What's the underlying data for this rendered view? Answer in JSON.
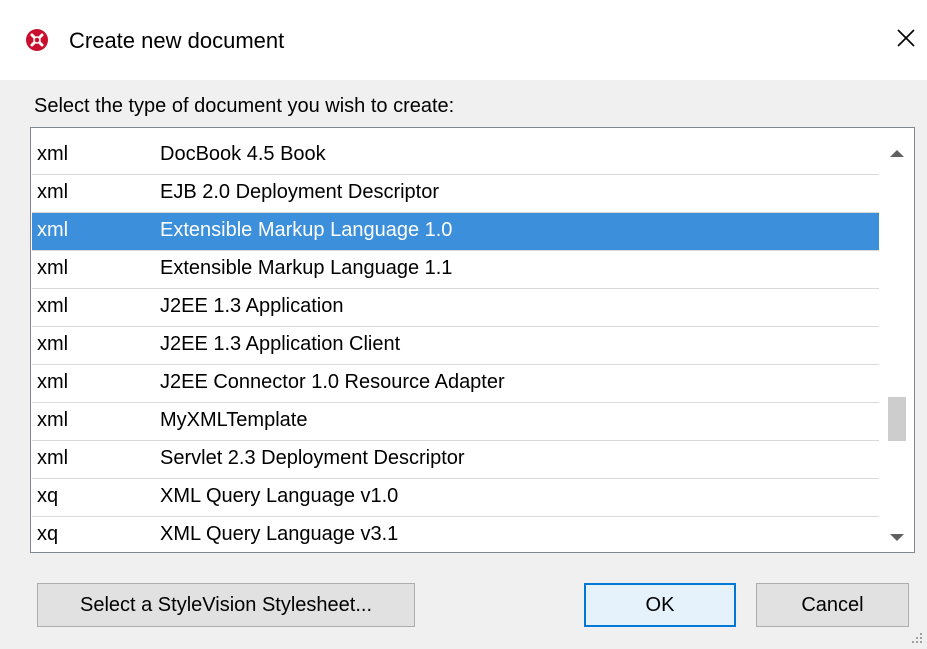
{
  "dialog": {
    "title": "Create new document",
    "app_icon": "altova-x-icon",
    "close_icon": "close-icon",
    "prompt": "Select the type of document you wish to create:"
  },
  "list": {
    "rows": [
      {
        "ext": "xml",
        "desc": "DocBook 4.5 Book",
        "selected": false
      },
      {
        "ext": "xml",
        "desc": "EJB 2.0 Deployment Descriptor",
        "selected": false
      },
      {
        "ext": "xml",
        "desc": "Extensible Markup Language 1.0",
        "selected": true
      },
      {
        "ext": "xml",
        "desc": "Extensible Markup Language 1.1",
        "selected": false
      },
      {
        "ext": "xml",
        "desc": "J2EE 1.3 Application",
        "selected": false
      },
      {
        "ext": "xml",
        "desc": "J2EE 1.3 Application Client",
        "selected": false
      },
      {
        "ext": "xml",
        "desc": "J2EE Connector 1.0 Resource Adapter",
        "selected": false
      },
      {
        "ext": "xml",
        "desc": "MyXMLTemplate",
        "selected": false
      },
      {
        "ext": "xml",
        "desc": "Servlet 2.3 Deployment Descriptor",
        "selected": false
      },
      {
        "ext": "xq",
        "desc": "XML Query Language v1.0",
        "selected": false
      },
      {
        "ext": "xq",
        "desc": "XML Query Language v3.1",
        "selected": false
      }
    ],
    "selected_color": "#3b8fdb"
  },
  "buttons": {
    "stylevision": "Select a StyleVision Stylesheet...",
    "ok": "OK",
    "cancel": "Cancel"
  }
}
